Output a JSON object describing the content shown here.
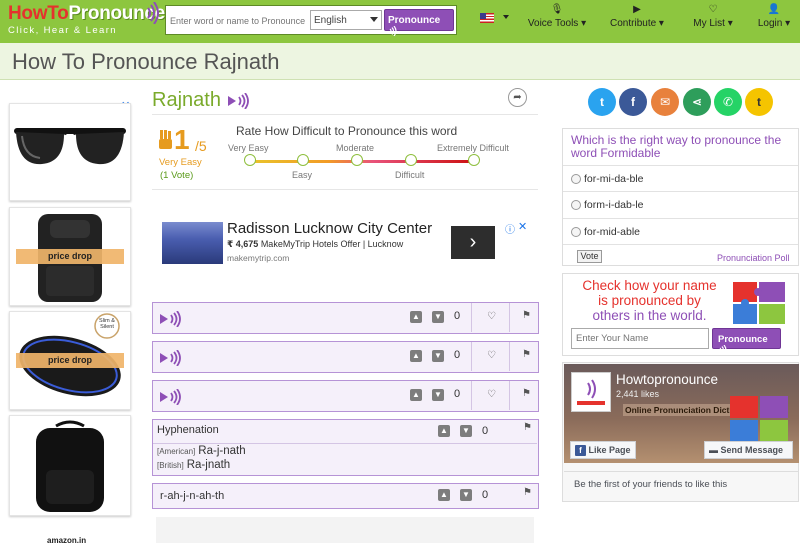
{
  "logo": {
    "part1": "HowTo",
    "part2": "Pronounce",
    "tagline": "Click, Hear & Learn"
  },
  "search": {
    "placeholder": "Enter word or name to Pronounce",
    "language": "English",
    "button": "Pronounce"
  },
  "nav": {
    "voice_tools": "Voice Tools",
    "contribute": "Contribute",
    "my_list": "My List",
    "login": "Login"
  },
  "page_title": "How To Pronounce Rajnath",
  "word": "Rajnath",
  "rating": {
    "score": "1",
    "out_of": "/5",
    "level": "Very Easy",
    "votes": "(1 Vote)",
    "question": "Rate How Difficult to Pronounce this word",
    "scale": [
      "Very Easy",
      "Easy",
      "Moderate",
      "Difficult",
      "Extremely Difficult"
    ]
  },
  "left_ads": {
    "price_drop": "price drop",
    "slim_badge": "Slim & Silent",
    "footer": "amazon.in"
  },
  "hotel_ad": {
    "name": "Radisson Lucknow City Center",
    "price": "₹ 4,675",
    "offer": "MakeMyTrip Hotels Offer | Lucknow",
    "url": "makemytrip.com"
  },
  "pronunciations": [
    {
      "up": "0"
    },
    {
      "up": "0"
    },
    {
      "up": "0"
    }
  ],
  "hyphenation": {
    "title": "Hyphenation",
    "votes": "0",
    "american_tag": "[American]",
    "american": "Ra-j-nath",
    "british_tag": "[British]",
    "british": "Ra-jnath"
  },
  "phonetic": {
    "text": "r-ah-j-n-ah-th",
    "votes": "0"
  },
  "social": [
    "twitter",
    "facebook",
    "email",
    "share",
    "whatsapp",
    "tumblr"
  ],
  "poll": {
    "question": "Which is the right way to pronounce the word Formidable",
    "options": [
      "for-mi-da-ble",
      "form-i-dab-le",
      "for-mid-able"
    ],
    "vote_button": "Vote",
    "link": "Pronunciation Poll"
  },
  "check_name": {
    "line1": "Check how your name",
    "line2": "is pronounced by",
    "line3": "others in the world.",
    "placeholder": "Enter Your Name",
    "button": "Pronounce"
  },
  "facebook": {
    "page_name": "Howtopronounce",
    "likes": "2,441 likes",
    "tagline": "Online Pronunciation Dictionary",
    "like_button": "Like Page",
    "send_button": "Send Message",
    "friends": "Be the first of your friends to like this"
  },
  "colors": {
    "green": "#8dc63f",
    "purple": "#8e4fb6",
    "orange": "#e69b1f",
    "red": "#e5322d"
  }
}
